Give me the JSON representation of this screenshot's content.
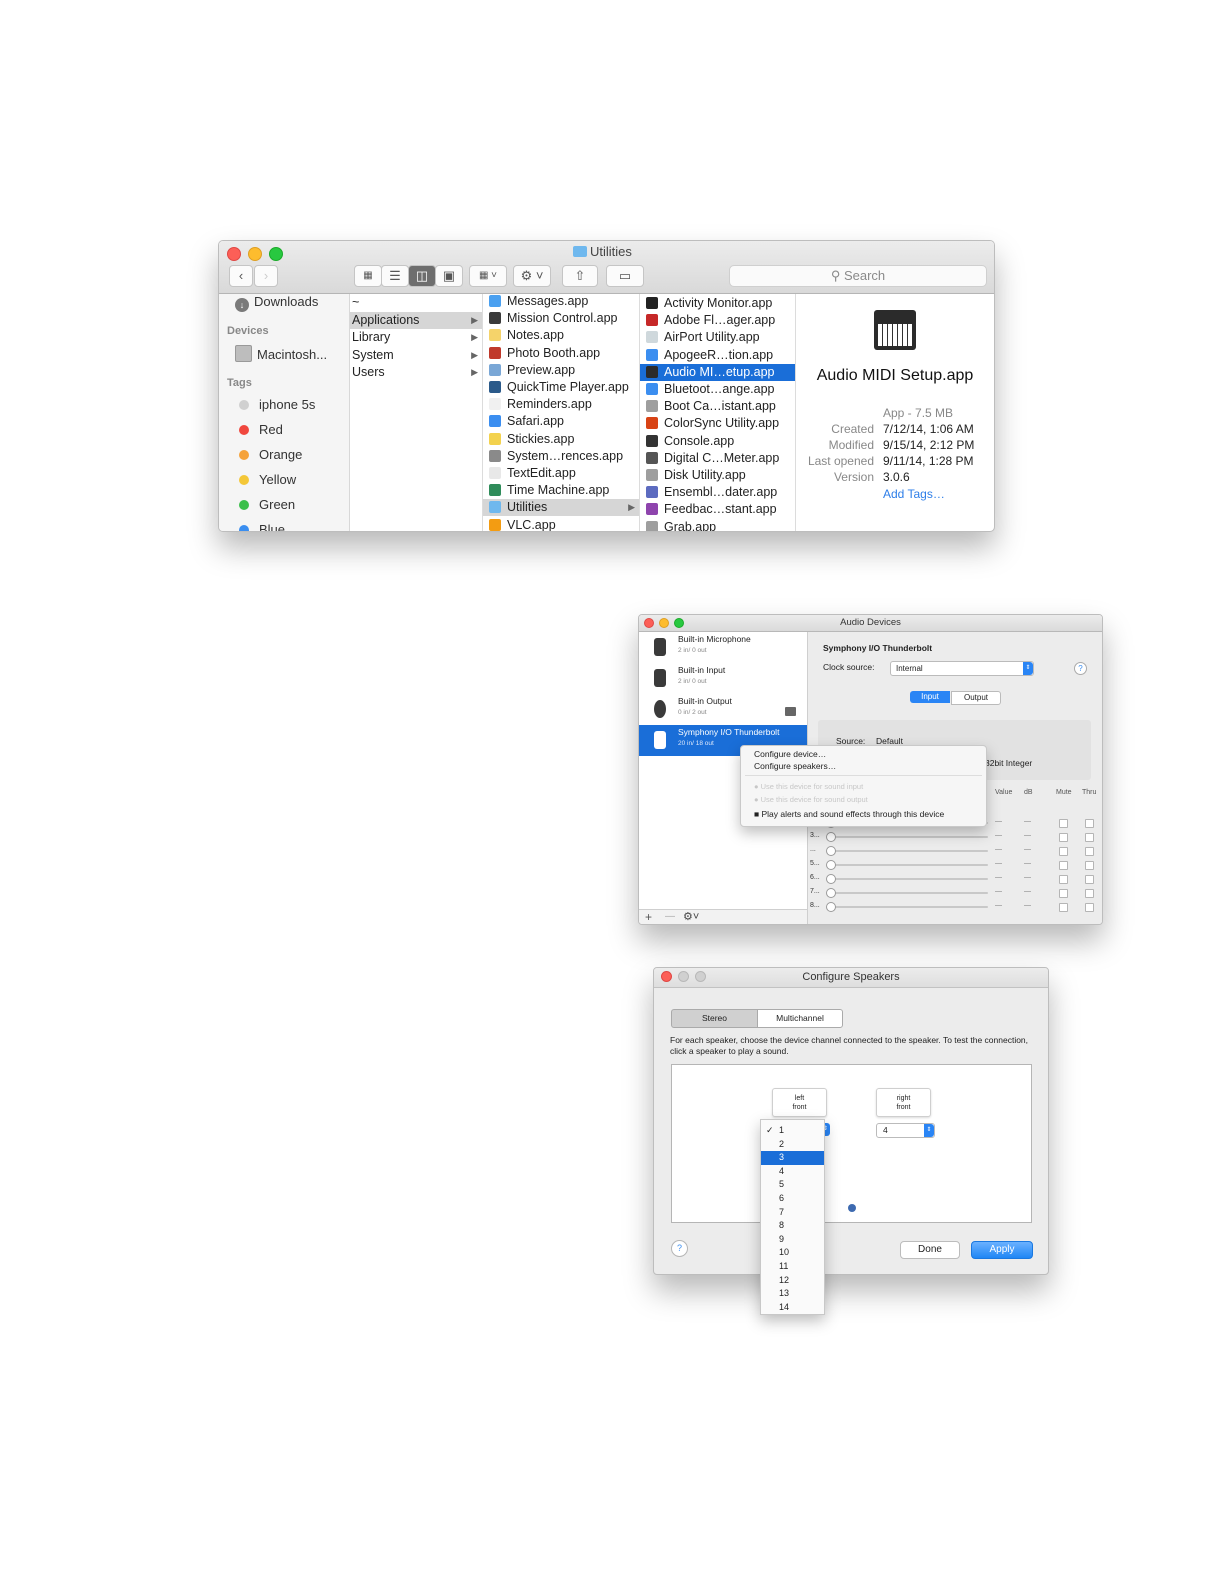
{
  "finder": {
    "title": "Utilities",
    "search_placeholder": "Search",
    "sidebar": {
      "favorites": [
        {
          "label": "Downloads",
          "icon": "download-icon"
        }
      ],
      "devices_header": "Devices",
      "devices": [
        {
          "label": "Macintosh...",
          "icon": "hard-disk-icon"
        }
      ],
      "tags_header": "Tags",
      "tags": [
        {
          "label": "iphone 5s",
          "color": "#d0d0d0"
        },
        {
          "label": "Red",
          "color": "#f0473e"
        },
        {
          "label": "Orange",
          "color": "#f5a23a"
        },
        {
          "label": "Yellow",
          "color": "#f4c738"
        },
        {
          "label": "Green",
          "color": "#3bbf4a"
        },
        {
          "label": "Blue",
          "color": "#3a8ef0"
        }
      ]
    },
    "column1": [
      "~",
      "Applications",
      "Library",
      "System",
      "Users"
    ],
    "column2": [
      "Messages.app",
      "Mission Control.app",
      "Notes.app",
      "Photo Booth.app",
      "Preview.app",
      "QuickTime Player.app",
      "Reminders.app",
      "Safari.app",
      "Stickies.app",
      "System…rences.app",
      "TextEdit.app",
      "Time Machine.app",
      "Utilities",
      "VLC.app"
    ],
    "column3": [
      "Activity Monitor.app",
      "Adobe Fl…ager.app",
      "AirPort Utility.app",
      "ApogeeR…tion.app",
      "Audio MI…etup.app",
      "Bluetoot…ange.app",
      "Boot Ca…istant.app",
      "ColorSync Utility.app",
      "Console.app",
      "Digital C…Meter.app",
      "Disk Utility.app",
      "Ensembl…dater.app",
      "Feedbac…stant.app",
      "Grab.app"
    ],
    "preview": {
      "name": "Audio MIDI Setup.app",
      "kind": "App - 7.5 MB",
      "created_label": "Created",
      "created": "7/12/14, 1:06 AM",
      "modified_label": "Modified",
      "modified": "9/15/14, 2:12 PM",
      "opened_label": "Last opened",
      "opened": "9/11/14, 1:28 PM",
      "version_label": "Version",
      "version": "3.0.6",
      "add_tags": "Add Tags…"
    }
  },
  "audio_devices": {
    "title": "Audio Devices",
    "devices": [
      {
        "name": "Built-in Microphone",
        "io": "2 in/ 0 out"
      },
      {
        "name": "Built-in Input",
        "io": "2 in/ 0 out"
      },
      {
        "name": "Built-in Output",
        "io": "0 in/ 2 out"
      },
      {
        "name": "Symphony I/O Thunderbolt",
        "io": "20 in/ 18 out"
      }
    ],
    "detail_title": "Symphony I/O Thunderbolt",
    "clock_label": "Clock source:",
    "clock_value": "Internal",
    "tab_input": "Input",
    "tab_output": "Output",
    "source_label": "Source:",
    "source_value": "Default",
    "format_text": "32bit Integer",
    "col_headers": [
      "Value",
      "dB",
      "Mute",
      "Thru"
    ],
    "channel_labels": [
      "2...",
      "3...",
      "...",
      "5...",
      "6...",
      "7...",
      "8..."
    ],
    "dash": "—",
    "context_menu": [
      "Configure device…",
      "Configure speakers…",
      "Use this device for sound input",
      "Use this device for sound output",
      "Play alerts and sound effects through this device"
    ],
    "add_label": "+",
    "remove_label": "—"
  },
  "configure_speakers": {
    "title": "Configure Speakers",
    "tab_stereo": "Stereo",
    "tab_multichannel": "Multichannel",
    "instructions": "For each speaker, choose the device channel connected to the speaker. To test the connection, click a speaker to play a sound.",
    "left_speaker": "left\nfront",
    "right_speaker": "right\nfront",
    "right_channel": "4",
    "channel_options": [
      "1",
      "2",
      "3",
      "4",
      "5",
      "6",
      "7",
      "8",
      "9",
      "10",
      "11",
      "12",
      "13",
      "14"
    ],
    "checked_option": "1",
    "highlighted_option": "3",
    "check_mark": "✓",
    "done_label": "Done",
    "apply_label": "Apply",
    "help_label": "?"
  }
}
